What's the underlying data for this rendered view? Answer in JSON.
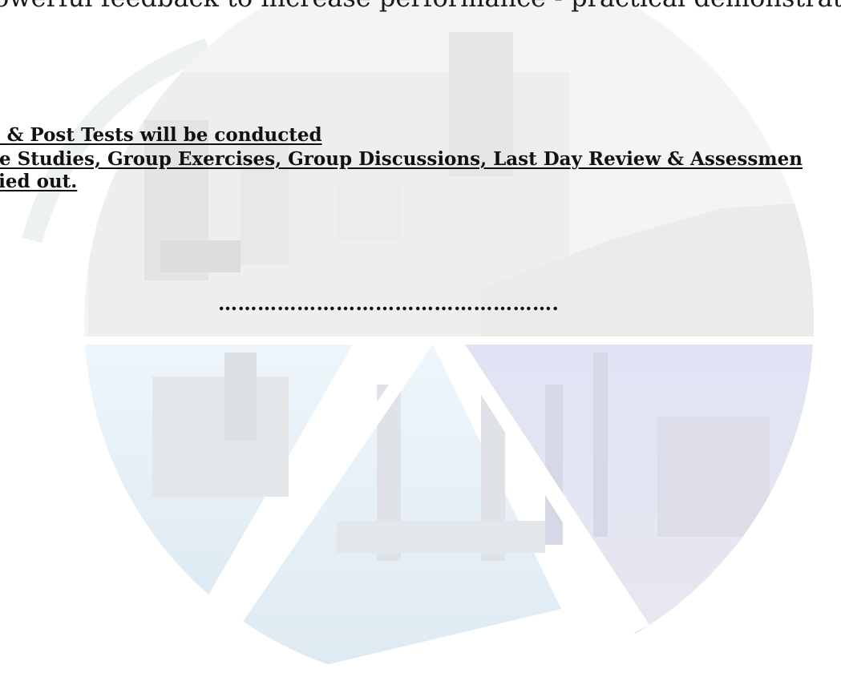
{
  "document": {
    "intro_line": "owerful feedback to increase performance - practical demonstrations by the",
    "items": [
      "e & Post Tests will be conducted",
      "se Studies, Group Exercises, Group Discussions, Last Day Review & Assessmen",
      "ried out."
    ],
    "separator": "……………………………………………."
  }
}
